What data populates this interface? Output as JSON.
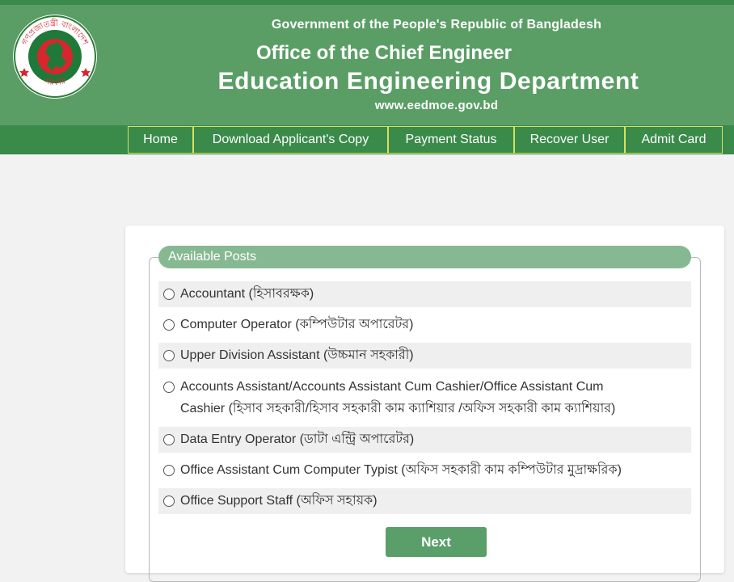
{
  "header": {
    "gov_line": "Government of the People's Republic of Bangladesh",
    "office_line": "Office of the Chief Engineer",
    "dept_line": "Education Engineering Department",
    "website": "www.eedmoe.gov.bd",
    "logo_top_text": "গণপ্রজাতন্ত্রী বাংলাদেশ",
    "logo_bottom_text": "সরকার",
    "logo_icon": "bangladesh-government-seal",
    "colors": {
      "header_bg": "#5a9e66",
      "nav_bg": "#3a8a4a",
      "nav_border": "#d8e060"
    }
  },
  "nav": {
    "items": [
      {
        "label": "Home"
      },
      {
        "label": "Download Applicant's Copy"
      },
      {
        "label": "Payment Status"
      },
      {
        "label": "Recover User"
      },
      {
        "label": "Admit Card"
      }
    ]
  },
  "form": {
    "legend": "Available Posts",
    "options": [
      {
        "line1": "Accountant (হিসাবরক্ষক)",
        "line2": ""
      },
      {
        "line1": "Computer Operator (কম্পিউটার অপারেটর)",
        "line2": ""
      },
      {
        "line1": "Upper Division Assistant (উচ্চমান সহকারী)",
        "line2": ""
      },
      {
        "line1": "Accounts Assistant/Accounts Assistant Cum Cashier/Office Assistant Cum",
        "line2": "Cashier (হিসাব সহকারী/হিসাব সহকারী কাম ক্যাশিয়ার /অফিস সহকারী কাম ক্যাশিয়ার)"
      },
      {
        "line1": "Data Entry Operator (ডাটা এন্ট্রি অপারেটর)",
        "line2": ""
      },
      {
        "line1": "Office Assistant Cum Computer Typist (অফিস সহকারী কাম কম্পিউটার মুদ্রাক্ষরিক)",
        "line2": ""
      },
      {
        "line1": "Office Support Staff (অফিস সহায়ক)",
        "line2": ""
      }
    ],
    "next_label": "Next",
    "colors": {
      "legend_bg": "#86b992",
      "button_bg": "#5a9e6a"
    }
  }
}
